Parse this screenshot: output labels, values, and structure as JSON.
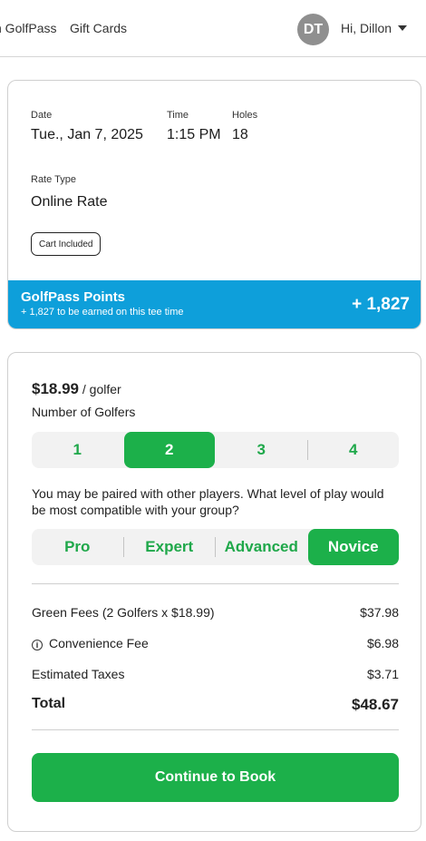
{
  "header": {
    "nav": [
      "n GolfPass",
      "Gift Cards"
    ],
    "avatar_initials": "DT",
    "greeting": "Hi, Dillon",
    "menu_icon": "chevron-down-icon"
  },
  "booking": {
    "date_label": "Date",
    "date": "Tue., Jan 7, 2025",
    "time_label": "Time",
    "time": "1:15 PM",
    "holes_label": "Holes",
    "holes": "18",
    "rate_type_label": "Rate Type",
    "rate_type": "Online Rate",
    "badge": "Cart Included"
  },
  "points": {
    "title": "GolfPass Points",
    "subtitle": "+ 1,827 to be earned on this tee time",
    "value": "+ 1,827",
    "color": "#0e9fda"
  },
  "pricing": {
    "price": "$18.99",
    "per": "/ golfer",
    "golfers_label": "Number of Golfers",
    "golfer_options": [
      "1",
      "2",
      "3",
      "4"
    ],
    "selected_golfers": "2",
    "pairing_text": "You may be paired with other players. What level of play would be most compatible with your group?",
    "level_options": [
      "Pro",
      "Expert",
      "Advanced",
      "Novice"
    ],
    "selected_level": "Novice",
    "accent": "#1cb04a"
  },
  "summary": {
    "green_fees_label": "Green Fees (2 Golfers x $18.99)",
    "green_fees": "$37.98",
    "convenience_label": "Convenience Fee",
    "convenience": "$6.98",
    "convenience_icon": "info-icon",
    "taxes_label": "Estimated Taxes",
    "taxes": "$3.71",
    "total_label": "Total",
    "total": "$48.67"
  },
  "cta": {
    "label": "Continue to Book"
  }
}
